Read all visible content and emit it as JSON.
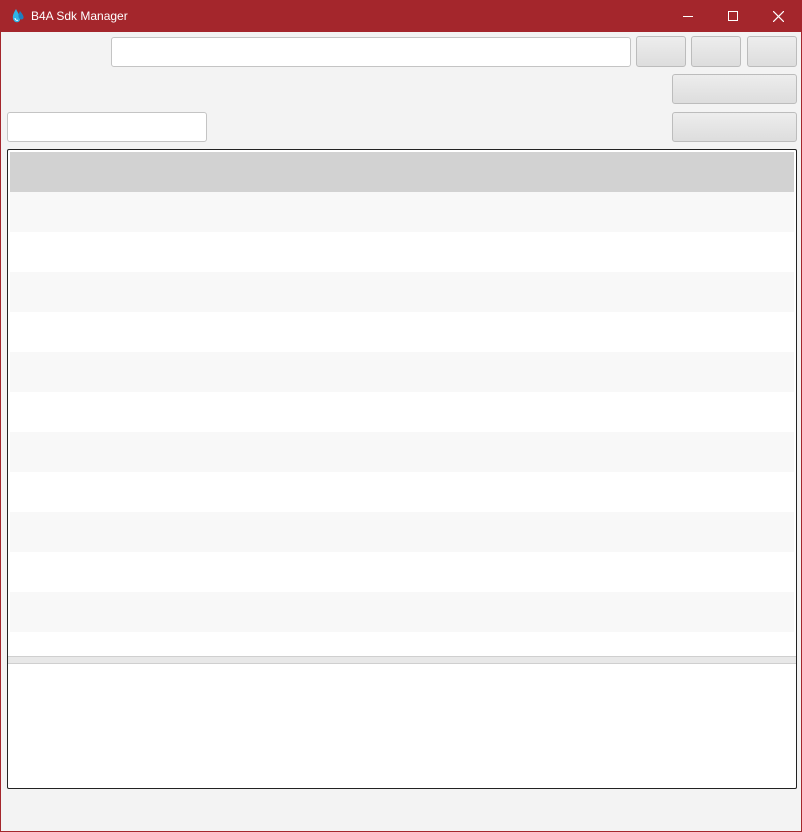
{
  "window": {
    "title": "B4A Sdk Manager",
    "app_icon": "b4a-droplet-icon",
    "accent_color": "#a4262c",
    "controls": [
      "minimize-icon",
      "maximize-icon",
      "close-icon"
    ]
  },
  "toolbar": {
    "path_input": {
      "value": "",
      "placeholder": ""
    },
    "buttons": [
      "",
      "",
      ""
    ],
    "wide_buttons": [
      "",
      ""
    ]
  },
  "filter": {
    "value": "",
    "placeholder": ""
  },
  "table": {
    "columns": [],
    "rows": []
  },
  "log": {
    "text": ""
  }
}
